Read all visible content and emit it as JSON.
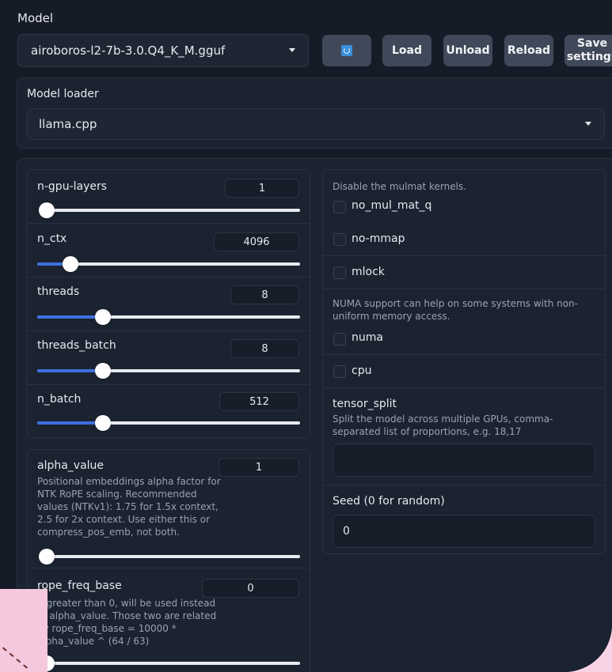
{
  "colors": {
    "accent": "#3d6fe0",
    "background": "#161c27",
    "panel": "#1b2230",
    "button": "#404959"
  },
  "header": {
    "model_label": "Model",
    "model_selected": "airoboros-l2-7b-3.0.Q4_K_M.gguf",
    "refresh_icon": "refresh-icon",
    "buttons": {
      "load": "Load",
      "unload": "Unload",
      "reload": "Reload",
      "save": "Save settings"
    }
  },
  "loader": {
    "label": "Model loader",
    "selected": "llama.cpp"
  },
  "sliders": {
    "n_gpu_layers": {
      "label": "n-gpu-layers",
      "value": "1",
      "fraction": 0.0
    },
    "n_ctx": {
      "label": "n_ctx",
      "value": "4096",
      "fraction": 0.125
    },
    "threads": {
      "label": "threads",
      "value": "8",
      "fraction": 0.25
    },
    "threads_batch": {
      "label": "threads_batch",
      "value": "8",
      "fraction": 0.25
    },
    "n_batch": {
      "label": "n_batch",
      "value": "512",
      "fraction": 0.25
    },
    "alpha_value": {
      "label": "alpha_value",
      "value": "1",
      "fraction": 0.0,
      "desc": "Positional embeddings alpha factor for NTK RoPE scaling. Recommended values (NTKv1): 1.75 for 1.5x context, 2.5 for 2x context. Use either this or compress_pos_emb, not both."
    },
    "rope_freq_base": {
      "label": "rope_freq_base",
      "value": "0",
      "fraction": 0.0,
      "desc": "If greater than 0, will be used instead of alpha_value. Those two are related by rope_freq_base = 10000 * alpha_value ^ (64 / 63)"
    }
  },
  "options": {
    "mulmat_info": "Disable the mulmat kernels.",
    "no_mul_mat_q": "no_mul_mat_q",
    "no_mmap": "no-mmap",
    "mlock": "mlock",
    "numa_info": "NUMA support can help on some systems with non-uniform memory access.",
    "numa": "numa",
    "cpu": "cpu"
  },
  "tensor_split": {
    "label": "tensor_split",
    "desc": "Split the model across multiple GPUs, comma-separated list of proportions, e.g. 18,17",
    "value": ""
  },
  "seed": {
    "label": "Seed (0 for random)",
    "value": "0"
  }
}
